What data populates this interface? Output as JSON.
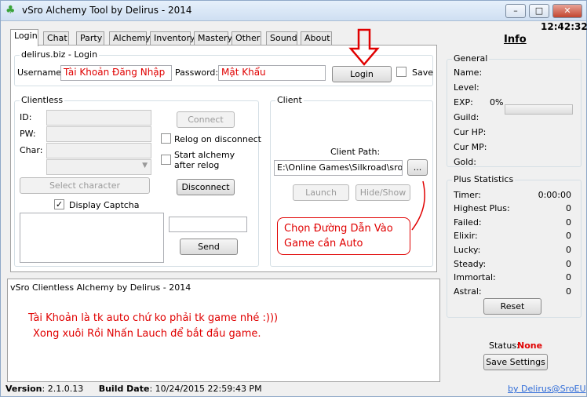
{
  "window": {
    "title": "vSro Alchemy Tool by Delirus - 2014",
    "clock": "12:42:32"
  },
  "tabs": [
    "Login",
    "Chat",
    "Party",
    "Alchemy",
    "Inventory",
    "Mastery",
    "Other",
    "Sound",
    "About"
  ],
  "login": {
    "group_title": "delirus.biz - Login",
    "username_label": "Username:",
    "username_value": "Tài Khoản Đăng Nhập",
    "password_label": "Password:",
    "password_value": "Mật Khẩu",
    "login_button": "Login",
    "save_label": "Save"
  },
  "clientless": {
    "group_title": "Clientless",
    "id_label": "ID:",
    "pw_label": "PW:",
    "char_label": "Char:",
    "select_character_button": "Select character",
    "connect_button": "Connect",
    "relog_label": "Relog on disconnect",
    "start_alchemy_label": "Start alchemy after relog",
    "disconnect_button": "Disconnect",
    "display_captcha_label": "Display Captcha",
    "send_button": "Send"
  },
  "client": {
    "group_title": "Client",
    "path_label": "Client Path:",
    "path_value": "E:\\Online Games\\Silkroad\\sro_cl",
    "browse_button": "...",
    "launch_button": "Launch",
    "hide_show_button": "Hide/Show"
  },
  "annotations": {
    "client_path_note": "Chọn Đường Dẫn Vào Game cần Auto",
    "log_note_1": "Tài Khoản là tk auto chứ ko phải tk game nhé :)))",
    "log_note_2": "Xong xuôi Rồi Nhấn Lauch để bắt đầu game."
  },
  "log": {
    "text": "vSro Clientless Alchemy by Delirus - 2014"
  },
  "info": {
    "title": "Info",
    "general_title": "General",
    "name_label": "Name:",
    "level_label": "Level:",
    "exp_label": "EXP:",
    "exp_value": "0%",
    "guild_label": "Guild:",
    "cur_hp_label": "Cur HP:",
    "cur_mp_label": "Cur MP:",
    "gold_label": "Gold:"
  },
  "plus_statistics": {
    "title": "Plus Statistics",
    "rows": [
      {
        "label": "Timer:",
        "value": "0:00:00"
      },
      {
        "label": "Highest Plus:",
        "value": "0"
      },
      {
        "label": "Failed:",
        "value": "0"
      },
      {
        "label": "Elixir:",
        "value": "0"
      },
      {
        "label": "Lucky:",
        "value": "0"
      },
      {
        "label": "Steady:",
        "value": "0"
      },
      {
        "label": "Immortal:",
        "value": "0"
      },
      {
        "label": "Astral:",
        "value": "0"
      }
    ],
    "reset_button": "Reset"
  },
  "status": {
    "label": "Status:",
    "value": "None",
    "save_settings_button": "Save Settings"
  },
  "footer": {
    "version_label": "Version",
    "version_value": ": 2.1.0.13",
    "build_label": "Build Date",
    "build_value": ": 10/24/2015 22:59:43 PM",
    "link": "by Delirus@SroEU"
  },
  "colors": {
    "accent_red": "#e00000",
    "link_blue": "#2e6bd8"
  }
}
